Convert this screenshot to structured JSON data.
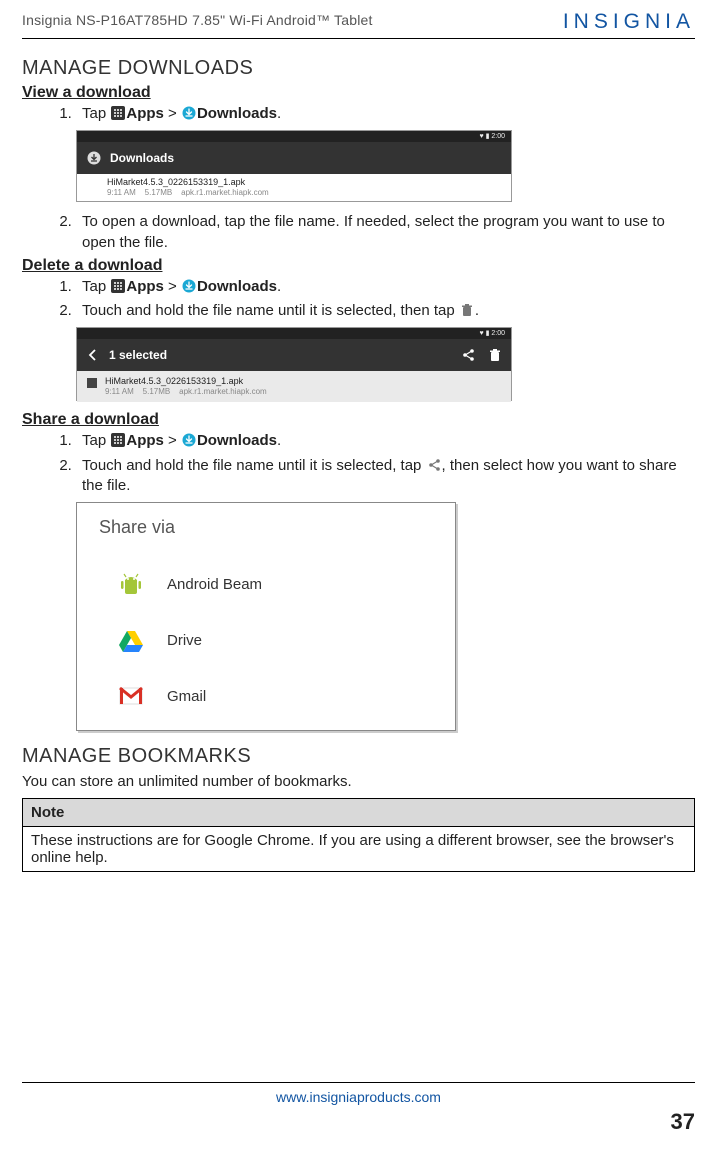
{
  "header": {
    "product_line": "Insignia  NS-P16AT785HD  7.85\" Wi-Fi Android™ Tablet",
    "brand": "INSIGNIA"
  },
  "sections": {
    "manage_downloads": {
      "title": "MANAGE DOWNLOADS",
      "view": {
        "heading": "View a download",
        "step1_pre": "Tap ",
        "step1_apps": "Apps",
        "step1_gt": " > ",
        "step1_downloads": "Downloads",
        "step1_suffix": ".",
        "step2": "To open a download, tap the file name. If needed, select the program you want to use to open the file."
      },
      "delete": {
        "heading": "Delete a download",
        "step1_pre": "Tap ",
        "step1_apps": "Apps",
        "step1_gt": " > ",
        "step1_downloads": "Downloads",
        "step1_suffix": ".",
        "step2_pre": "Touch and hold the file name until it is selected, then tap ",
        "step2_suffix": "."
      },
      "share": {
        "heading": "Share a download",
        "step1_pre": "Tap ",
        "step1_apps": "Apps",
        "step1_gt": " > ",
        "step1_downloads": "Downloads",
        "step1_suffix": ".",
        "step2_pre": "Touch and hold the file name until it is selected, tap ",
        "step2_mid": ", then select how you want to share the file."
      }
    },
    "manage_bookmarks": {
      "title": "MANAGE BOOKMARKS",
      "intro": "You can store an unlimited number of bookmarks.",
      "note_label": "Note",
      "note_body": "These instructions are for Google Chrome. If you are using a different browser, see the browser's online help."
    }
  },
  "screenshots": {
    "downloads": {
      "time": "♥ ▮ 2:00",
      "header": "Downloads",
      "file": "HiMarket4.5.3_0226153319_1.apk",
      "meta_time": "9:11 AM",
      "meta_size": "5.17MB",
      "meta_src": "apk.r1.market.hiapk.com"
    },
    "selected": {
      "time": "♥ ▮ 2:00",
      "header": "1 selected",
      "file": "HiMarket4.5.3_0226153319_1.apk",
      "meta_time": "9:11 AM",
      "meta_size": "5.17MB",
      "meta_src": "apk.r1.market.hiapk.com"
    },
    "share": {
      "title": "Share via",
      "opt1": "Android Beam",
      "opt2": "Drive",
      "opt3": "Gmail"
    }
  },
  "footer": {
    "url": "www.insigniaproducts.com",
    "page": "37"
  }
}
